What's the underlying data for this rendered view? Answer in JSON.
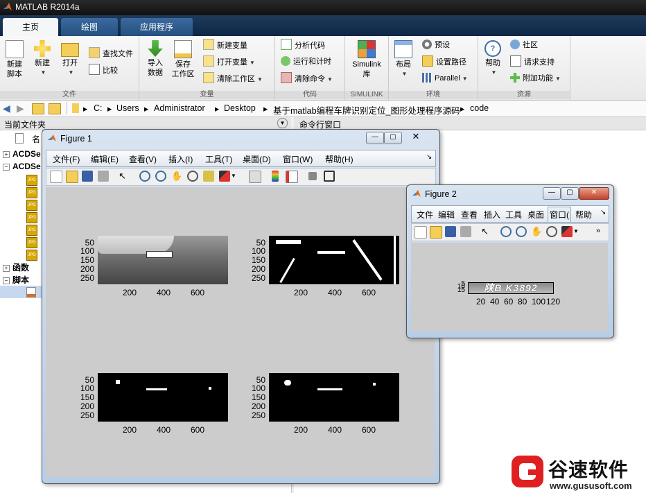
{
  "app": {
    "title": "MATLAB R2014a"
  },
  "tabs": [
    "主页",
    "绘图",
    "应用程序"
  ],
  "ribbon": {
    "file_group": {
      "label": "文件",
      "new_script": "新建\n脚本",
      "new": "新建",
      "open": "打开",
      "find_files": "查找文件",
      "compare": "比较"
    },
    "variable_group": {
      "label": "变量",
      "import": "导入\n数据",
      "save_ws": "保存\n工作区",
      "new_var": "新建变量",
      "open_var": "打开变量",
      "clear_ws": "清除工作区"
    },
    "code_group": {
      "label": "代码",
      "analyze": "分析代码",
      "run_time": "运行和计时",
      "clear_cmd": "清除命令"
    },
    "simulink_group": {
      "label": "SIMULINK",
      "simulink": "Simulink\n库"
    },
    "env_group": {
      "label": "环境",
      "layout": "布局",
      "prefs": "预设",
      "set_path": "设置路径",
      "parallel": "Parallel"
    },
    "res_group": {
      "label": "资源",
      "help": "帮助",
      "community": "社区",
      "support": "请求支持",
      "addons": "附加功能"
    }
  },
  "address": {
    "crumbs": [
      "C:",
      "Users",
      "Administrator",
      "Desktop",
      "基于matlab编程车牌识别定位_图形处理程序源码",
      "code"
    ]
  },
  "panels": {
    "current_folder": "当前文件夹",
    "command_window": "命令行窗口",
    "name_col": "名"
  },
  "tree": {
    "items": [
      "ACDSe",
      "ACDSe",
      "函数",
      "脚本"
    ]
  },
  "figure1": {
    "title": "Figure 1",
    "menus": [
      "文件(F)",
      "编辑(E)",
      "查看(V)",
      "插入(I)",
      "工具(T)",
      "桌面(D)",
      "窗口(W)",
      "帮助(H)"
    ],
    "yticks": [
      "50",
      "100",
      "150",
      "200",
      "250"
    ],
    "xticks": [
      "200",
      "400",
      "600"
    ]
  },
  "figure2": {
    "title": "Figure 2",
    "menus": [
      "文件",
      "编辑",
      "查看",
      "插入",
      "工具",
      "桌面",
      "窗口(",
      "帮助"
    ],
    "plate_text": "陕B K3892",
    "yticks": [
      "5",
      "10",
      "15"
    ],
    "xticks": [
      "20",
      "40",
      "60",
      "80",
      "100",
      "120"
    ]
  },
  "watermark": {
    "name": "谷速软件",
    "url": "www.gususoft.com"
  },
  "colors": {
    "tab_active": "#f5f6f7",
    "figure_bg": "#cccccc",
    "brand_red": "#e02020"
  }
}
